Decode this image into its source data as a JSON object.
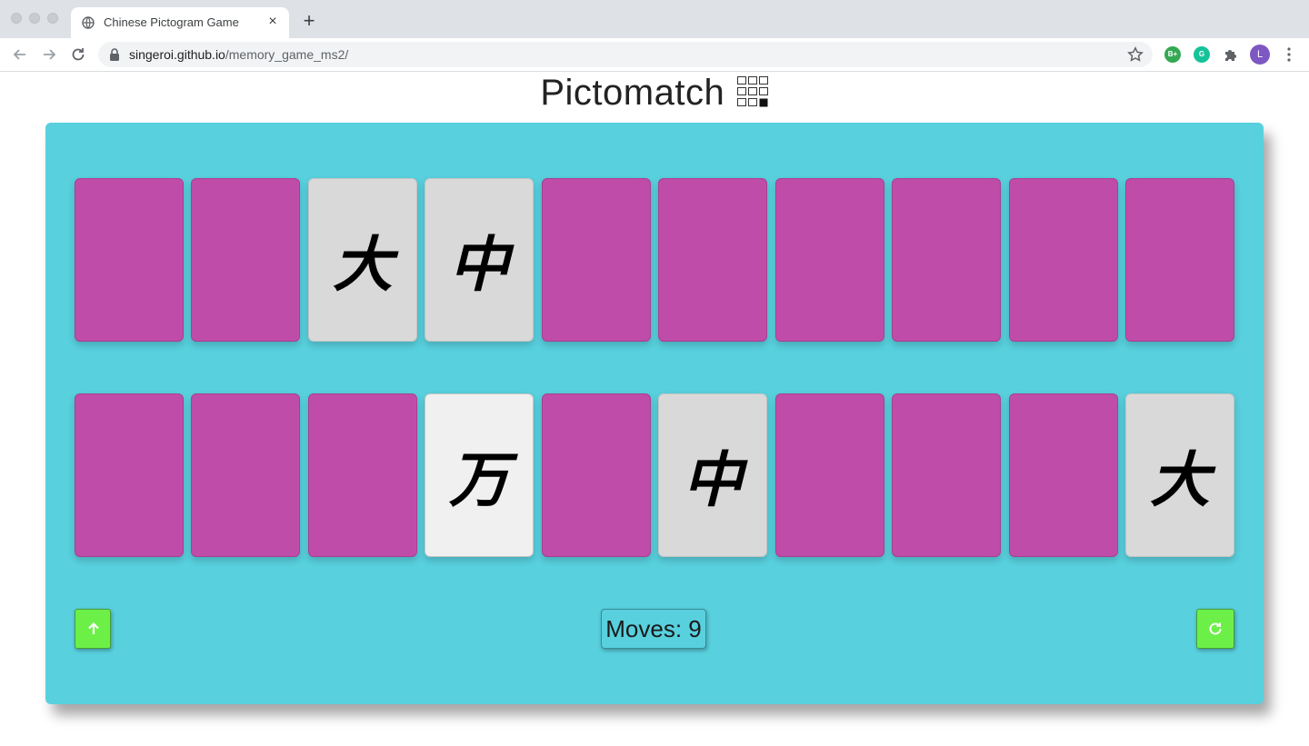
{
  "browser": {
    "tab_title": "Chinese Pictogram Game",
    "new_tab_label": "+",
    "close_label": "×",
    "url_host": "singeroi.github.io",
    "url_path": "/memory_game_ms2/",
    "extensions": [
      {
        "icon": "bplus-extension-icon",
        "text": "B+",
        "color": "#34a853"
      },
      {
        "icon": "grammarly-extension-icon",
        "text": "G",
        "color": "#15c39a"
      },
      {
        "icon": "puzzle-extensions-icon",
        "text": "",
        "color": "#5f6368"
      }
    ],
    "profile_initial": "L",
    "profile_color": "#7e57c2"
  },
  "header": {
    "title": "Pictomatch",
    "logo_icon": "grid-logo-icon"
  },
  "board": {
    "background": "#58d0de",
    "card_back_color": "#c04ca9",
    "card_face_color": "#d9d9d9",
    "rows": [
      [
        {
          "state": "down",
          "glyph": ""
        },
        {
          "state": "down",
          "glyph": ""
        },
        {
          "state": "up",
          "glyph": "大"
        },
        {
          "state": "up",
          "glyph": "中"
        },
        {
          "state": "down",
          "glyph": ""
        },
        {
          "state": "down",
          "glyph": ""
        },
        {
          "state": "down",
          "glyph": ""
        },
        {
          "state": "down",
          "glyph": ""
        },
        {
          "state": "down",
          "glyph": ""
        },
        {
          "state": "down",
          "glyph": ""
        }
      ],
      [
        {
          "state": "down",
          "glyph": ""
        },
        {
          "state": "down",
          "glyph": ""
        },
        {
          "state": "down",
          "glyph": ""
        },
        {
          "state": "up",
          "glyph": "万",
          "highlight": true
        },
        {
          "state": "down",
          "glyph": ""
        },
        {
          "state": "up",
          "glyph": "中"
        },
        {
          "state": "down",
          "glyph": ""
        },
        {
          "state": "down",
          "glyph": ""
        },
        {
          "state": "down",
          "glyph": ""
        },
        {
          "state": "up",
          "glyph": "大"
        }
      ]
    ]
  },
  "controls": {
    "scroll_up_icon": "arrow-up-icon",
    "restart_icon": "restart-icon",
    "button_color": "#6cf048",
    "moves_label": "Moves: 9"
  }
}
